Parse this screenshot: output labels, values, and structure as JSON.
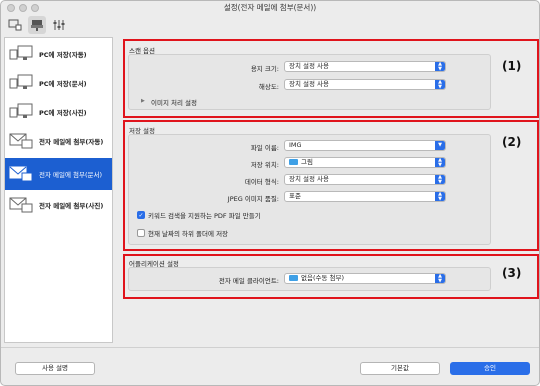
{
  "window": {
    "title": "설정(전자 메일에 첨부(문서))"
  },
  "toolbar": {
    "tabs": [
      {
        "icon": "scan-from-computer-icon"
      },
      {
        "icon": "scan-from-panel-icon"
      },
      {
        "icon": "general-settings-icon"
      }
    ]
  },
  "sidebar": {
    "items": [
      {
        "label": "PC에 저장(자동)"
      },
      {
        "label": "PC에 저장(문서)"
      },
      {
        "label": "PC에 저장(사진)"
      },
      {
        "label": "전자 메일에 첨부(자동)"
      },
      {
        "label": "전자 메일에 첨부(문서)"
      },
      {
        "label": "전자 메일에 첨부(사진)"
      }
    ]
  },
  "scan_options": {
    "title": "스캔 옵션",
    "paper_size_label": "용지 크기:",
    "paper_size_value": "장치 설정 사용",
    "resolution_label": "해상도:",
    "resolution_value": "장치 설정 사용",
    "image_processing_label": "이미지 처리 설정",
    "marker": "(1)"
  },
  "save_settings": {
    "title": "저장 설정",
    "file_name_label": "파일 이름:",
    "file_name_value": "IMG",
    "save_in_label": "저장 위치:",
    "save_in_value": "그림",
    "data_format_label": "데이터 형식:",
    "data_format_value": "장치 설정 사용",
    "jpeg_quality_label": "JPEG 이미지 품질:",
    "jpeg_quality_value": "표준",
    "keyword_pdf_label": "키워드 검색을 지원하는 PDF 파일 만들기",
    "subfolder_label": "현재 날짜의 하위 폴더에 저장",
    "marker": "(2)"
  },
  "app_settings": {
    "title": "어플리케이션 설정",
    "mail_client_label": "전자 메일 클라이언트:",
    "mail_client_value": "없음(수동 첨부)",
    "marker": "(3)"
  },
  "footer": {
    "instructions_label": "사용 설명",
    "defaults_label": "기본값",
    "ok_label": "승인"
  }
}
